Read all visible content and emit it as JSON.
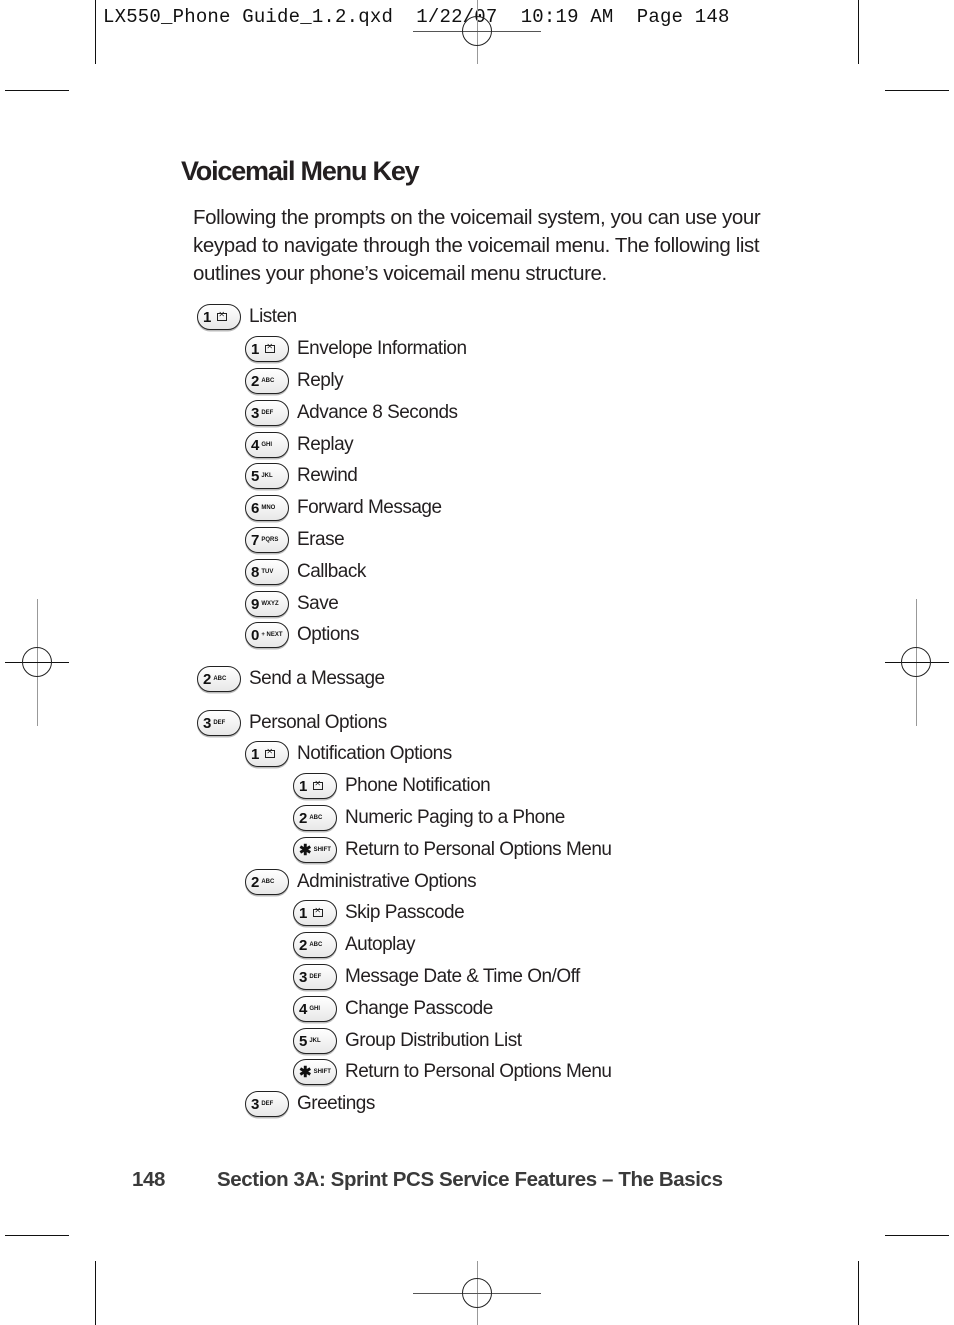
{
  "slug": {
    "file": "LX550_Phone Guide_1.2.qxd",
    "date": "1/22/07",
    "time": "10:19 AM",
    "page": "Page 148"
  },
  "page": {
    "title": "Voicemail Menu Key",
    "intro": "Following the prompts on the voicemail system, you can use your keypad to navigate through the voicemail menu. The following list outlines your phone’s voicemail menu structure."
  },
  "menu": [
    {
      "key": "1",
      "sub": "envelope",
      "label": "Listen",
      "level": 0
    },
    {
      "key": "1",
      "sub": "envelope",
      "label": "Envelope Information",
      "level": 1
    },
    {
      "key": "2",
      "sub": "ABC",
      "label": "Reply",
      "level": 1
    },
    {
      "key": "3",
      "sub": "DEF",
      "label": "Advance 8 Seconds",
      "level": 1
    },
    {
      "key": "4",
      "sub": "GHI",
      "label": "Replay",
      "level": 1
    },
    {
      "key": "5",
      "sub": "JKL",
      "label": "Rewind",
      "level": 1
    },
    {
      "key": "6",
      "sub": "MNO",
      "label": "Forward Message",
      "level": 1
    },
    {
      "key": "7",
      "sub": "PQRS",
      "label": "Erase",
      "level": 1
    },
    {
      "key": "8",
      "sub": "TUV",
      "label": "Callback",
      "level": 1
    },
    {
      "key": "9",
      "sub": "WXYZ",
      "label": "Save",
      "level": 1
    },
    {
      "key": "0",
      "sub": "+ NEXT",
      "label": "Options",
      "level": 1
    },
    {
      "key": "2",
      "sub": "ABC",
      "label": "Send a Message",
      "level": 0
    },
    {
      "key": "3",
      "sub": "DEF",
      "label": "Personal Options",
      "level": 0
    },
    {
      "key": "1",
      "sub": "envelope",
      "label": "Notification Options",
      "level": 1
    },
    {
      "key": "1",
      "sub": "envelope",
      "label": "Phone Notification",
      "level": 2
    },
    {
      "key": "2",
      "sub": "ABC",
      "label": "Numeric Paging to a Phone",
      "level": 2
    },
    {
      "key": "*",
      "sub": "SHIFT",
      "label": "Return to Personal Options Menu",
      "level": 2
    },
    {
      "key": "2",
      "sub": "ABC",
      "label": "Administrative Options",
      "level": 1
    },
    {
      "key": "1",
      "sub": "envelope",
      "label": "Skip Passcode",
      "level": 2
    },
    {
      "key": "2",
      "sub": "ABC",
      "label": "Autoplay",
      "level": 2
    },
    {
      "key": "3",
      "sub": "DEF",
      "label": "Message Date & Time On/Off",
      "level": 2
    },
    {
      "key": "4",
      "sub": "GHI",
      "label": "Change Passcode",
      "level": 2
    },
    {
      "key": "5",
      "sub": "JKL",
      "label": "Group Distribution List",
      "level": 2
    },
    {
      "key": "*",
      "sub": "SHIFT",
      "label": "Return to Personal Options Menu",
      "level": 2
    },
    {
      "key": "3",
      "sub": "DEF",
      "label": "Greetings",
      "level": 1
    }
  ],
  "footer": {
    "page_number": "148",
    "section": "Section 3A: Sprint PCS Service Features – The Basics"
  }
}
